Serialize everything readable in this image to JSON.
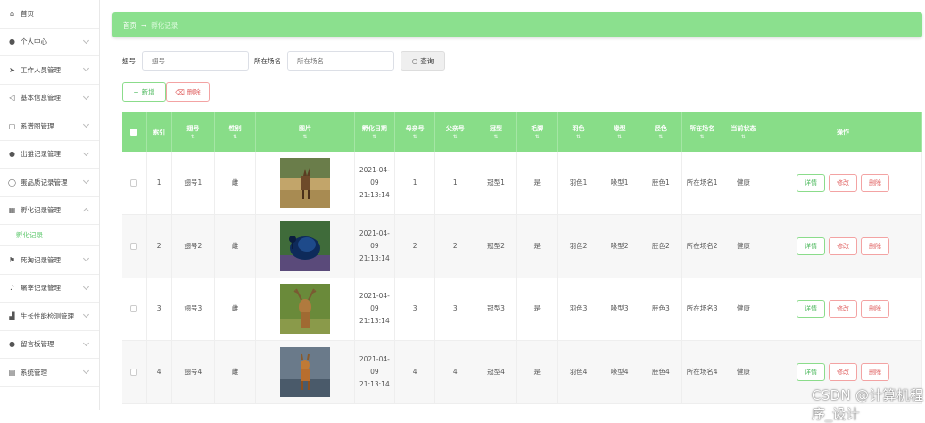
{
  "sidebar": {
    "items": [
      {
        "label": "首页",
        "icon": "home-icon",
        "has_chevron": false
      },
      {
        "label": "个人中心",
        "icon": "user-icon",
        "has_chevron": true
      },
      {
        "label": "工作人员管理",
        "icon": "send-icon",
        "has_chevron": true
      },
      {
        "label": "基本信息管理",
        "icon": "paper-plane-icon",
        "has_chevron": true
      },
      {
        "label": "系谱图管理",
        "icon": "copy-icon",
        "has_chevron": true
      },
      {
        "label": "出雏记录管理",
        "icon": "user-icon",
        "has_chevron": true
      },
      {
        "label": "蛋品质记录管理",
        "icon": "clock-icon",
        "has_chevron": true
      },
      {
        "label": "孵化记录管理",
        "icon": "grid-icon",
        "has_chevron": true,
        "expanded": true
      }
    ],
    "sub_active": "孵化记录",
    "items_after": [
      {
        "label": "死淘记录管理",
        "icon": "flag-icon"
      },
      {
        "label": "屠宰记录管理",
        "icon": "mic-icon"
      },
      {
        "label": "生长性能检测管理",
        "icon": "chart-icon"
      },
      {
        "label": "留言板管理",
        "icon": "person-icon"
      },
      {
        "label": "系统管理",
        "icon": "table-icon"
      }
    ]
  },
  "breadcrumb": {
    "home": "首页",
    "arrow": "→",
    "current": "孵化记录"
  },
  "search": {
    "label1": "翅号",
    "placeholder1": "翅号",
    "label2": "所在场名",
    "placeholder2": "所在场名",
    "query_button": "查询"
  },
  "toolbar": {
    "add_label": "新增",
    "delete_label": "删除"
  },
  "table": {
    "headers": [
      "索引",
      "翅号",
      "性别",
      "图片",
      "孵化日期",
      "母亲号",
      "父亲号",
      "冠型",
      "毛脚",
      "羽色",
      "喙型",
      "胫色",
      "所在场名",
      "当前状态",
      "操作"
    ],
    "rows": [
      {
        "index": "1",
        "wing": "翅号1",
        "sex": "雌",
        "date": "2021-04-09 21:13:14",
        "mother": "1",
        "father": "1",
        "comb": "冠型1",
        "feet": "是",
        "feather": "羽色1",
        "beak": "喙型1",
        "shank": "胫色1",
        "farm": "所在场名1",
        "status": "健康"
      },
      {
        "index": "2",
        "wing": "翅号2",
        "sex": "雌",
        "date": "2021-04-09 21:13:14",
        "mother": "2",
        "father": "2",
        "comb": "冠型2",
        "feet": "是",
        "feather": "羽色2",
        "beak": "喙型2",
        "shank": "胫色2",
        "farm": "所在场名2",
        "status": "健康"
      },
      {
        "index": "3",
        "wing": "翅号3",
        "sex": "雌",
        "date": "2021-04-09 21:13:14",
        "mother": "3",
        "father": "3",
        "comb": "冠型3",
        "feet": "是",
        "feather": "羽色3",
        "beak": "喙型3",
        "shank": "胫色3",
        "farm": "所在场名3",
        "status": "健康"
      },
      {
        "index": "4",
        "wing": "翅号4",
        "sex": "雌",
        "date": "2021-04-09 21:13:14",
        "mother": "4",
        "father": "4",
        "comb": "冠型4",
        "feet": "是",
        "feather": "羽色4",
        "beak": "喙型4",
        "shank": "胫色4",
        "farm": "所在场名4",
        "status": "健康"
      }
    ],
    "row_actions": {
      "detail": "详情",
      "edit": "修改",
      "delete": "删除"
    }
  },
  "watermark": "CSDN @计算机程序_设计",
  "colors": {
    "accent": "#88dd88",
    "danger": "#e06060",
    "success": "#4cb85c"
  }
}
